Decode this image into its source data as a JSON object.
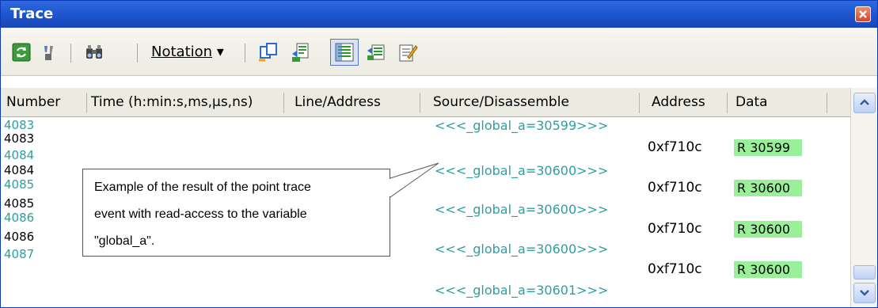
{
  "window": {
    "title": "Trace"
  },
  "toolbar": {
    "notation_label": "Notation",
    "notation_arrow": "▾"
  },
  "columns": [
    "Number",
    "Time (h:min:s,ms,μs,ns)",
    "Line/Address",
    "Source/Disassemble",
    "Address",
    "Data"
  ],
  "rows": [
    {
      "number": "4083",
      "source": "<<<_global_a=30599>>>",
      "kind": "source"
    },
    {
      "number": "4083",
      "address": "0xf710c",
      "data": "R 30599",
      "kind": "access"
    },
    {
      "number": "4084",
      "source": "<<<_global_a=30600>>>",
      "kind": "source"
    },
    {
      "number": "4084",
      "address": "0xf710c",
      "data": "R 30600",
      "kind": "access"
    },
    {
      "number": "4085",
      "source": "<<<_global_a=30600>>>",
      "kind": "source"
    },
    {
      "number": "4085",
      "address": "0xf710c",
      "data": "R 30600",
      "kind": "access"
    },
    {
      "number": "4086",
      "source": "<<<_global_a=30600>>>",
      "kind": "source"
    },
    {
      "number": "4086",
      "address": "0xf710c",
      "data": "R 30600",
      "kind": "access"
    },
    {
      "number": "4087",
      "source": "<<<_global_a=30601>>>",
      "kind": "source"
    }
  ],
  "callout": {
    "line1": "Example of the result of the point trace",
    "line2": "event with read-access to the variable",
    "line3": "\"global_a\"."
  },
  "colors": {
    "title_bar": "#1e55cf",
    "source_text": "#2aa0a0",
    "data_highlight": "#99f099"
  }
}
